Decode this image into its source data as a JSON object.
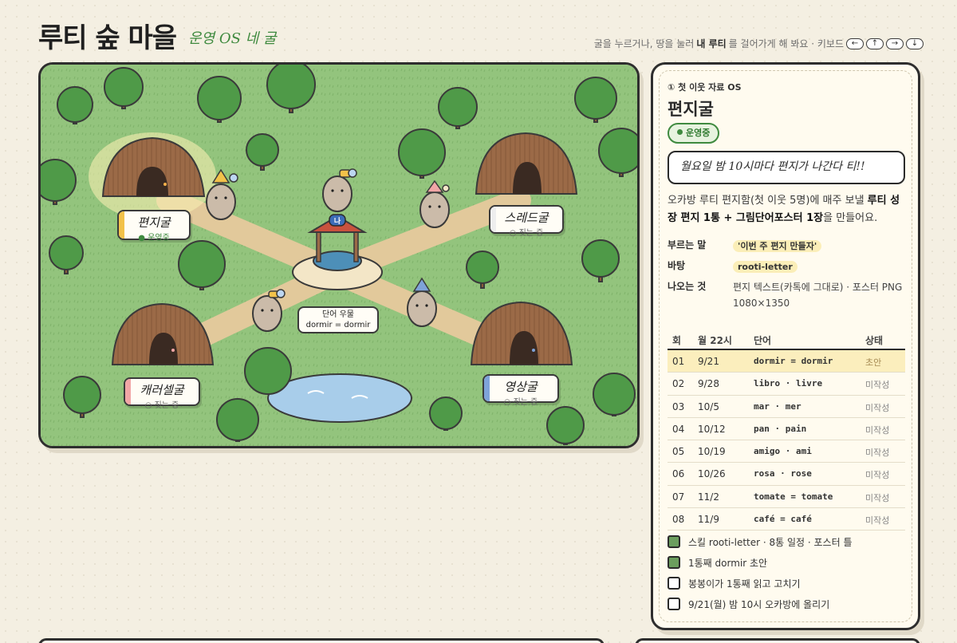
{
  "header": {
    "title": "루티 숲 마을",
    "subtitle": "운영 OS 네 굴",
    "hint_prefix": "굴을 누르거나, 땅을 눌러",
    "hint_bold": "내 루티",
    "hint_suffix": "를 걸어가게 해 봐요 · 키보드",
    "keys": [
      "←",
      "↑",
      "→",
      "↓"
    ]
  },
  "map": {
    "caves": [
      {
        "name": "편지굴",
        "status": "운영중",
        "active": true,
        "stripe": "#f2c24a"
      },
      {
        "name": "스레드굴",
        "status": "짓는 중",
        "active": false,
        "stripe": "#eee"
      },
      {
        "name": "캐러셀굴",
        "status": "짓는 중",
        "active": false,
        "stripe": "#f1a6a6"
      },
      {
        "name": "영상굴",
        "status": "짓는 중",
        "active": false,
        "stripe": "#7ea3d9"
      }
    ],
    "well_badge": "나",
    "signboard": {
      "line1": "단어 우물",
      "line2": "dormir = dormir"
    },
    "colors": {
      "grass": "#93c47d",
      "path": "#e2c99b",
      "tree": "#4f9a48",
      "cave": "#9b6a47",
      "water": "#a8cdea"
    }
  },
  "panel": {
    "eyebrow": "① 첫 이웃 자료 OS",
    "title": "편지굴",
    "badge": "운영중",
    "speech": "월요일 밤 10시마다 편지가 나간다 티!!",
    "desc": {
      "p1": "오카방 루티 편지함(첫 이웃 5명)에 매주 보낼 ",
      "b1": "루티 성장 편지 1통 + 그림단어포스터 1장",
      "p2": "을 만들어요."
    },
    "fields": [
      {
        "key": "부르는 말",
        "value": "'이번 주 편지 만들자'"
      },
      {
        "key": "바탕",
        "value": "rooti-letter"
      },
      {
        "key": "나오는 것",
        "value": "편지 텍스트(카톡에 그대로) · 포스터 PNG 1080×1350"
      }
    ],
    "table": {
      "headers": [
        "회",
        "월 22시",
        "단어",
        "상태"
      ],
      "rows": [
        {
          "no": "01",
          "date": "9/21",
          "word": "dormir = dormir",
          "status": "초안",
          "current": true
        },
        {
          "no": "02",
          "date": "9/28",
          "word": "libro · livre",
          "status": "미작성",
          "current": false
        },
        {
          "no": "03",
          "date": "10/5",
          "word": "mar · mer",
          "status": "미작성",
          "current": false
        },
        {
          "no": "04",
          "date": "10/12",
          "word": "pan · pain",
          "status": "미작성",
          "current": false
        },
        {
          "no": "05",
          "date": "10/19",
          "word": "amigo · ami",
          "status": "미작성",
          "current": false
        },
        {
          "no": "06",
          "date": "10/26",
          "word": "rosa · rose",
          "status": "미작성",
          "current": false
        },
        {
          "no": "07",
          "date": "11/2",
          "word": "tomate = tomate",
          "status": "미작성",
          "current": false
        },
        {
          "no": "08",
          "date": "11/9",
          "word": "café = café",
          "status": "미작성",
          "current": false
        }
      ]
    },
    "checklist": [
      {
        "label": "스킬 rooti-letter · 8통 일정 · 포스터 틀",
        "done": true
      },
      {
        "label": "1통째 dormir 초안",
        "done": true
      },
      {
        "label": "봉봉이가 1통째 읽고 고치기",
        "done": false
      },
      {
        "label": "9/21(월) 밤 10시 오카방에 올리기",
        "done": false
      }
    ]
  }
}
